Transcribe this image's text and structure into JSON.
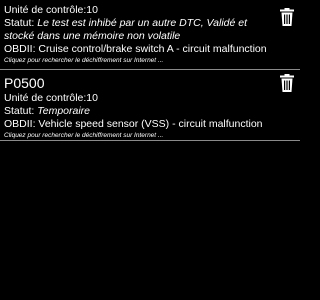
{
  "colors": {
    "background": "#000000",
    "text": "#ffffff",
    "divider": "#8a8a8a"
  },
  "codes": [
    {
      "code": "",
      "control_unit": "Unité de contrôle:10",
      "status_label": "Statut:",
      "status_value": "Le test est inhibé par un autre DTC, Validé et stocké dans une mémoire non volatile",
      "obd_description": "OBDII: Cruise control/brake switch A - circuit malfunction",
      "hint": "Cliquez pour rechercher le déchiffrement sur Internet ...",
      "delete_icon": "trash-icon"
    },
    {
      "code": "P0500",
      "control_unit": "Unité de contrôle:10",
      "status_label": "Statut:",
      "status_value": "Temporaire",
      "obd_description": "OBDII: Vehicle speed sensor (VSS) - circuit malfunction",
      "hint": "Cliquez pour rechercher le déchiffrement sur Internet ...",
      "delete_icon": "trash-icon"
    }
  ]
}
